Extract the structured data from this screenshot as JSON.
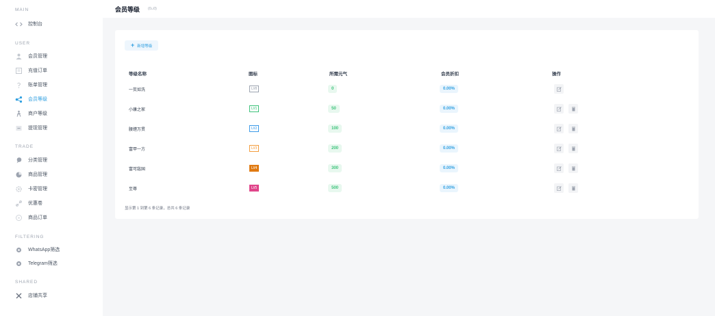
{
  "sidebar": {
    "sections": {
      "main": "MAIN",
      "user": "USER",
      "trade": "TRADE",
      "filtering": "FILTERING",
      "shared": "SHARED"
    },
    "items": {
      "dashboard": "控制台",
      "members": "会员管理",
      "recharge": "充值订单",
      "bills": "账单管理",
      "member_levels": "会员等级",
      "merchant_levels": "商户等级",
      "withdraw": "提现管理",
      "categories": "分类管理",
      "products": "商品管理",
      "cards": "卡密管理",
      "coupons": "优惠卷",
      "orders": "商品订单",
      "whatsapp": "WhatsApp筛选",
      "telegram": "Telegram筛选",
      "shop_share": "店铺共享"
    },
    "active": "member_levels",
    "accent_color": "#2f9fe0"
  },
  "header": {
    "title": "会员等级",
    "emote": "(0ᴗ0)"
  },
  "toolbar": {
    "add_label": "新增等级"
  },
  "table": {
    "headers": {
      "name": "等级名称",
      "icon": "图标",
      "energy": "所需元气",
      "discount": "会员折扣",
      "actions": "操作"
    },
    "rows": [
      {
        "name": "一贫如洗",
        "badge": "LV0",
        "badge_color": "#9ca3af",
        "energy": "0",
        "discount": "0.00%"
      },
      {
        "name": "小康之家",
        "badge": "LV1",
        "badge_color": "#3cc27a",
        "energy": "50",
        "discount": "0.00%"
      },
      {
        "name": "腰缠万贯",
        "badge": "LV2",
        "badge_color": "#3b9ae8",
        "energy": "100",
        "discount": "0.00%"
      },
      {
        "name": "富甲一方",
        "badge": "LV3",
        "badge_color": "#f39c3c",
        "energy": "200",
        "discount": "0.00%"
      },
      {
        "name": "富可敌国",
        "badge": "LV4",
        "badge_color": "#e07a12",
        "energy": "300",
        "discount": "0.00%"
      },
      {
        "name": "至尊",
        "badge": "LV5",
        "badge_color": "#e0458a",
        "energy": "500",
        "discount": "0.00%"
      }
    ],
    "footer": "显示第 1 到第 6 条记录，总共 6 条记录"
  }
}
